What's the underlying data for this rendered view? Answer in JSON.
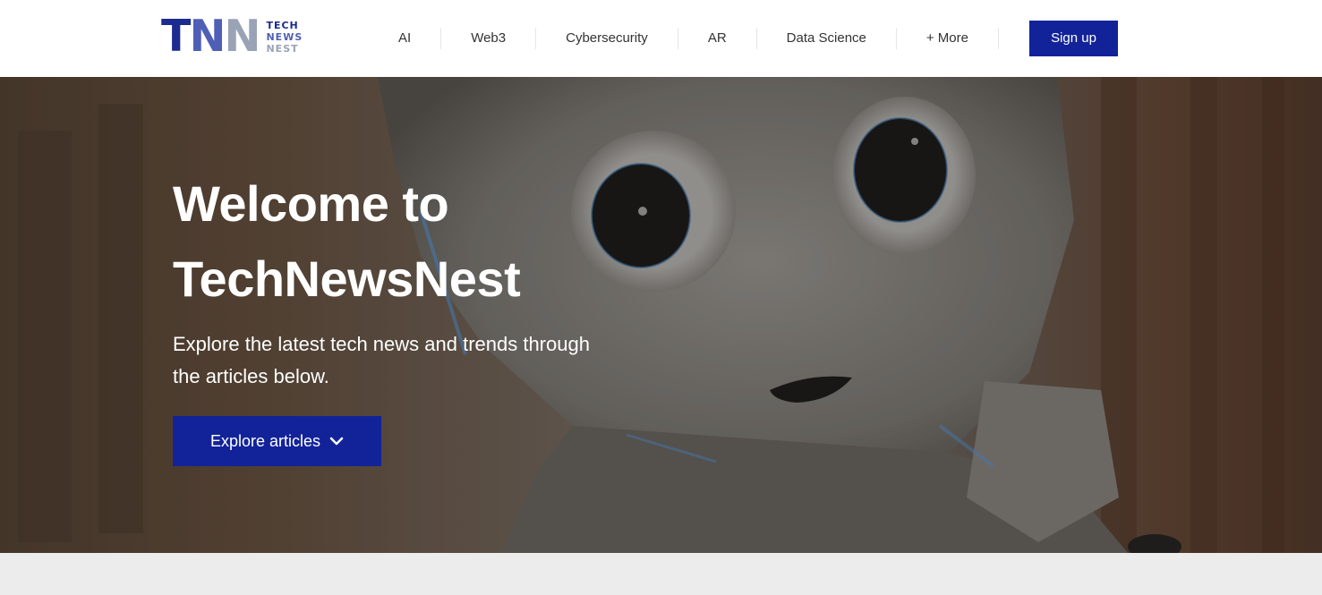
{
  "brand": {
    "letters": [
      "T",
      "N",
      "N"
    ],
    "words": [
      "TECH",
      "NEWS",
      "NEST"
    ],
    "colors": {
      "navy": "#1b2b8f",
      "blue": "#4f5fb5",
      "grey": "#9aa3b6"
    }
  },
  "nav": {
    "items": [
      {
        "label": "AI"
      },
      {
        "label": "Web3"
      },
      {
        "label": "Cybersecurity"
      },
      {
        "label": "AR"
      },
      {
        "label": "Data Science"
      },
      {
        "label": "+ More"
      }
    ],
    "signup_label": "Sign up"
  },
  "hero": {
    "title_line1": "Welcome to",
    "title_line2": "TechNewsNest",
    "subtitle_line1": "Explore the latest tech news and trends through",
    "subtitle_line2": "the articles below.",
    "cta_label": "Explore articles",
    "cta_icon": "chevron-down-icon",
    "image": "robot-photo"
  },
  "colors": {
    "accent": "#12239a",
    "header_bg": "#ffffff",
    "page_bg": "#ececec"
  }
}
